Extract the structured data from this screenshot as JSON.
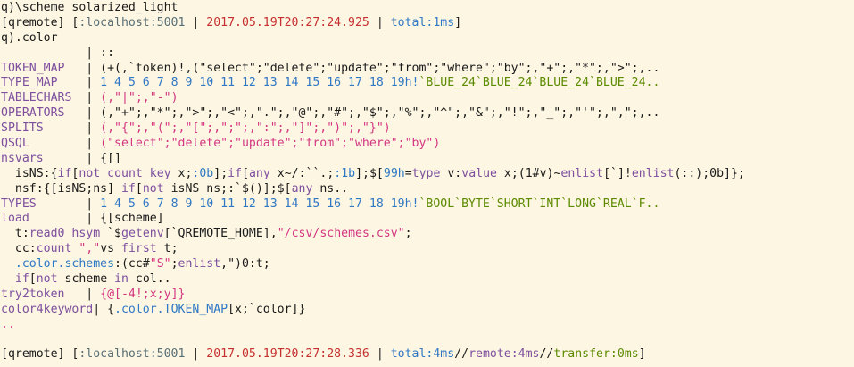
{
  "window": {
    "background": "#fdf6e3",
    "palette": {
      "foreground": "#1a1a1a",
      "keyword": "#7d4f9e",
      "blue": "#2f78c4",
      "string": "#d33682",
      "timestamp": "#c62f2f",
      "green": "#5c8a00"
    }
  },
  "lines": [
    {
      "kind": "input",
      "segments": [
        {
          "t": "q)\\scheme solarized_light",
          "c": "fg"
        }
      ]
    },
    {
      "kind": "output",
      "segments": [
        {
          "t": "[qremote] [",
          "c": "fg"
        },
        {
          "t": ":localhost:5001",
          "c": "gray"
        },
        {
          "t": " | ",
          "c": "fg"
        },
        {
          "t": "2017.05.19T20:27:24.925",
          "c": "time"
        },
        {
          "t": " | ",
          "c": "fg"
        },
        {
          "t": "total:1ms",
          "c": "blue"
        },
        {
          "t": "]",
          "c": "fg"
        }
      ]
    },
    {
      "kind": "input",
      "segments": [
        {
          "t": "q).color",
          "c": "fg"
        }
      ]
    },
    {
      "kind": "output",
      "segments": [
        {
          "t": "            | ::",
          "c": "fg"
        }
      ]
    },
    {
      "kind": "output",
      "segments": [
        {
          "t": "TOKEN_MAP",
          "c": "key"
        },
        {
          "t": "   | (+(,`token)!,(\"select\";\"delete\";\"update\";\"from\";\"where\";\"by\";,\"+\";,\"*\";,\">\";,..",
          "c": "fg"
        }
      ]
    },
    {
      "kind": "output",
      "segments": [
        {
          "t": "TYPE_MAP",
          "c": "key"
        },
        {
          "t": "    | ",
          "c": "fg"
        },
        {
          "t": "1 4 5 6 7 8 9 10 11 12 13 14 15 16 17 18 19h!",
          "c": "blue"
        },
        {
          "t": "`BLUE_24`BLUE_24`BLUE_24`BLUE_24..",
          "c": "green"
        }
      ]
    },
    {
      "kind": "output",
      "segments": [
        {
          "t": "TABLECHARS",
          "c": "key"
        },
        {
          "t": "  | ",
          "c": "fg"
        },
        {
          "t": "(,\"|\";,\"-\")",
          "c": "red"
        }
      ]
    },
    {
      "kind": "output",
      "segments": [
        {
          "t": "OPERATORS",
          "c": "key"
        },
        {
          "t": "   | (,\"+\";,\"*\";,\">\";,\"<\";,\".\";,\"@\";,\"#\";,\"$\";,\"%\";,\"^\";,\"&\";,\"!\";,\"_\";,\"'\";,\",\";,..",
          "c": "fg"
        }
      ]
    },
    {
      "kind": "output",
      "segments": [
        {
          "t": "SPLITS",
          "c": "key"
        },
        {
          "t": "      | ",
          "c": "fg"
        },
        {
          "t": "(,\"{\";,\"(\";,\"[\";,\";\";,\":\";,\"]\";,\")\";,\"}\")",
          "c": "red"
        }
      ]
    },
    {
      "kind": "output",
      "segments": [
        {
          "t": "QSQL",
          "c": "key"
        },
        {
          "t": "        | ",
          "c": "fg"
        },
        {
          "t": "(\"select\";\"delete\";\"update\";\"from\";\"where\";\"by\")",
          "c": "red"
        }
      ]
    },
    {
      "kind": "output",
      "segments": [
        {
          "t": "nsvars",
          "c": "key"
        },
        {
          "t": "      | {[]",
          "c": "fg"
        }
      ]
    },
    {
      "kind": "output",
      "segments": [
        {
          "t": "  isNS:{",
          "c": "fg"
        },
        {
          "t": "if",
          "c": "key"
        },
        {
          "t": "[",
          "c": "fg"
        },
        {
          "t": "not count key",
          "c": "key"
        },
        {
          "t": " x;",
          "c": "fg"
        },
        {
          "t": ":0b",
          "c": "blue"
        },
        {
          "t": "];",
          "c": "fg"
        },
        {
          "t": "if",
          "c": "key"
        },
        {
          "t": "[",
          "c": "fg"
        },
        {
          "t": "any",
          "c": "key"
        },
        {
          "t": " x~/:``.;",
          "c": "fg"
        },
        {
          "t": ":1b",
          "c": "blue"
        },
        {
          "t": "];$[",
          "c": "fg"
        },
        {
          "t": "99h",
          "c": "blue"
        },
        {
          "t": "=",
          "c": "fg"
        },
        {
          "t": "type",
          "c": "key"
        },
        {
          "t": " v:",
          "c": "fg"
        },
        {
          "t": "value",
          "c": "key"
        },
        {
          "t": " x;(1#v)~",
          "c": "fg"
        },
        {
          "t": "enlist",
          "c": "key"
        },
        {
          "t": "[`]!",
          "c": "fg"
        },
        {
          "t": "enlist",
          "c": "key"
        },
        {
          "t": "(::);0b]};",
          "c": "fg"
        }
      ]
    },
    {
      "kind": "output",
      "segments": [
        {
          "t": "  nsf:{[isNS;ns] ",
          "c": "fg"
        },
        {
          "t": "if",
          "c": "key"
        },
        {
          "t": "[",
          "c": "fg"
        },
        {
          "t": "not",
          "c": "key"
        },
        {
          "t": " isNS ns;:`$()];$[",
          "c": "fg"
        },
        {
          "t": "any",
          "c": "key"
        },
        {
          "t": " ns..",
          "c": "fg"
        }
      ]
    },
    {
      "kind": "output",
      "segments": [
        {
          "t": "TYPES",
          "c": "key"
        },
        {
          "t": "       | ",
          "c": "fg"
        },
        {
          "t": "1 4 5 6 7 8 9 10 11 12 13 14 15 16 17 18 19h!",
          "c": "blue"
        },
        {
          "t": "`BOOL`BYTE`SHORT`INT`LONG`REAL`F..",
          "c": "green"
        }
      ]
    },
    {
      "kind": "output",
      "segments": [
        {
          "t": "load",
          "c": "key"
        },
        {
          "t": "        | {[scheme]",
          "c": "fg"
        }
      ]
    },
    {
      "kind": "output",
      "segments": [
        {
          "t": "  t:",
          "c": "fg"
        },
        {
          "t": "read0 hsym",
          "c": "key"
        },
        {
          "t": " `$",
          "c": "fg"
        },
        {
          "t": "getenv",
          "c": "key"
        },
        {
          "t": "[`QREMOTE_HOME],",
          "c": "fg"
        },
        {
          "t": "\"/csv/schemes.csv\"",
          "c": "red"
        },
        {
          "t": ";",
          "c": "fg"
        }
      ]
    },
    {
      "kind": "output",
      "segments": [
        {
          "t": "  cc:",
          "c": "fg"
        },
        {
          "t": "count",
          "c": "key"
        },
        {
          "t": " ",
          "c": "fg"
        },
        {
          "t": "\",\"",
          "c": "red"
        },
        {
          "t": "vs ",
          "c": "fg"
        },
        {
          "t": "first",
          "c": "key"
        },
        {
          "t": " t;",
          "c": "fg"
        }
      ]
    },
    {
      "kind": "output",
      "segments": [
        {
          "t": "  .color.schemes",
          "c": "blue"
        },
        {
          "t": ":(cc#",
          "c": "fg"
        },
        {
          "t": "\"S\"",
          "c": "red"
        },
        {
          "t": ";",
          "c": "fg"
        },
        {
          "t": "enlist",
          "c": "key"
        },
        {
          "t": ",\")0:t;",
          "c": "fg"
        }
      ]
    },
    {
      "kind": "output",
      "segments": [
        {
          "t": "  ",
          "c": "fg"
        },
        {
          "t": "if",
          "c": "key"
        },
        {
          "t": "[",
          "c": "fg"
        },
        {
          "t": "not",
          "c": "key"
        },
        {
          "t": " scheme ",
          "c": "fg"
        },
        {
          "t": "in",
          "c": "key"
        },
        {
          "t": " col..",
          "c": "fg"
        }
      ]
    },
    {
      "kind": "output",
      "segments": [
        {
          "t": "try2token",
          "c": "key"
        },
        {
          "t": "   | ",
          "c": "fg"
        },
        {
          "t": "{@[-4!;x;y]}",
          "c": "red"
        }
      ]
    },
    {
      "kind": "output",
      "segments": [
        {
          "t": "color4keyword",
          "c": "key"
        },
        {
          "t": "| {",
          "c": "fg"
        },
        {
          "t": ".color.TOKEN_MAP",
          "c": "blue"
        },
        {
          "t": "[x;`color]}",
          "c": "fg"
        }
      ]
    },
    {
      "kind": "output",
      "segments": [
        {
          "t": "..",
          "c": "red"
        }
      ]
    },
    {
      "kind": "blank",
      "segments": [
        {
          "t": "",
          "c": "fg"
        }
      ]
    },
    {
      "kind": "output",
      "segments": [
        {
          "t": "[qremote] [",
          "c": "fg"
        },
        {
          "t": ":localhost:5001",
          "c": "gray"
        },
        {
          "t": " | ",
          "c": "fg"
        },
        {
          "t": "2017.05.19T20:27:28.336",
          "c": "time"
        },
        {
          "t": " | ",
          "c": "fg"
        },
        {
          "t": "total:4ms",
          "c": "blue"
        },
        {
          "t": "//",
          "c": "fg"
        },
        {
          "t": "remote:4ms",
          "c": "key"
        },
        {
          "t": "//",
          "c": "fg"
        },
        {
          "t": "transfer:0ms",
          "c": "green"
        },
        {
          "t": "]",
          "c": "fg"
        }
      ]
    }
  ]
}
